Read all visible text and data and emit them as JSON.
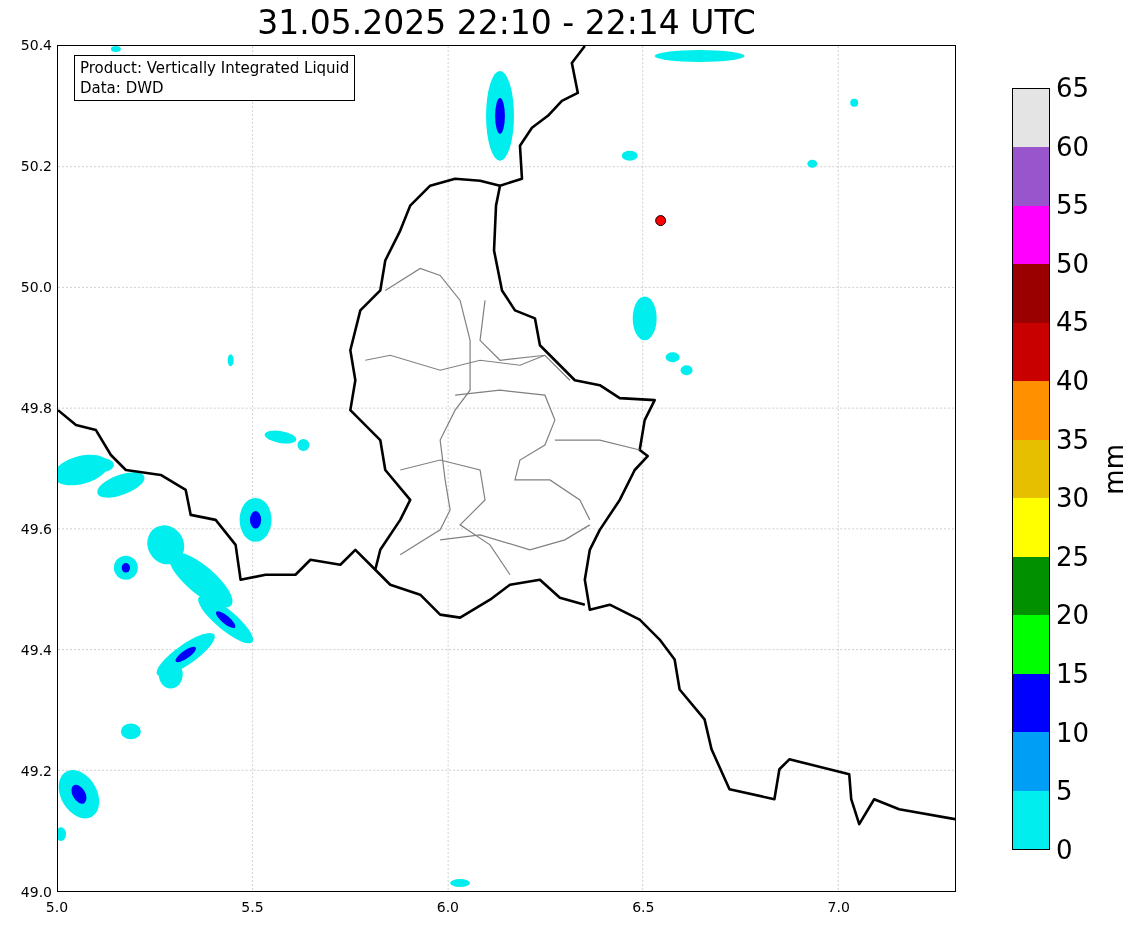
{
  "title": "31.05.2025 22:10 - 22:14 UTC",
  "legend": [
    "Product: Vertically Integrated Liquid",
    "Data: DWD"
  ],
  "axes": {
    "yticks": [
      "50.4",
      "50.2",
      "50.0",
      "49.8",
      "49.6",
      "49.4",
      "49.2",
      "49.0"
    ],
    "xticks": [
      "5.0",
      "5.5",
      "6.0",
      "6.5",
      "7.0"
    ]
  },
  "colorbar": {
    "label": "mm",
    "ticks": [
      "65",
      "60",
      "55",
      "50",
      "45",
      "40",
      "35",
      "30",
      "25",
      "20",
      "15",
      "10",
      "5",
      "0"
    ],
    "bins": [
      {
        "color": "#e4e4e4"
      },
      {
        "color": "#9955cc"
      },
      {
        "color": "#ff00ff"
      },
      {
        "color": "#9a0000"
      },
      {
        "color": "#c80000"
      },
      {
        "color": "#ff9000"
      },
      {
        "color": "#e6c000"
      },
      {
        "color": "#ffff00"
      },
      {
        "color": "#009000"
      },
      {
        "color": "#00ff00"
      },
      {
        "color": "#0000ff"
      },
      {
        "color": "#009ff5"
      },
      {
        "color": "#00eeee"
      }
    ]
  }
}
